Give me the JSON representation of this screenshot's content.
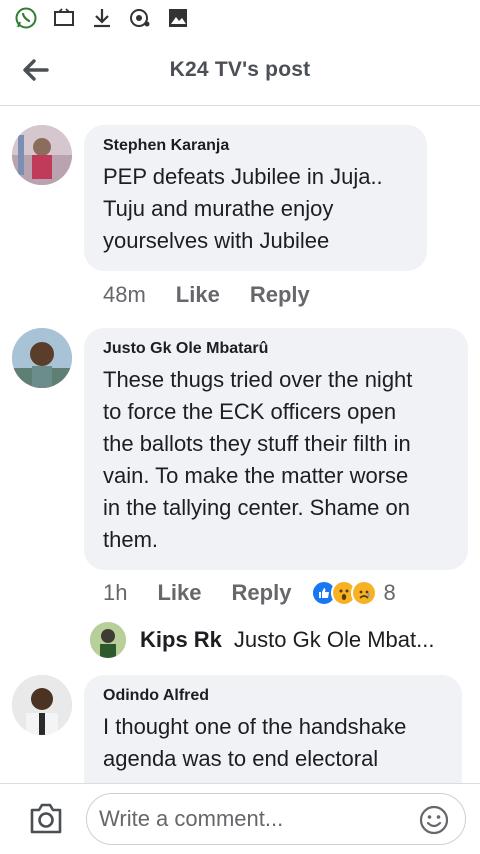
{
  "status_icons": [
    "whatsapp-icon",
    "cast-icon",
    "download-icon",
    "notification-icon",
    "gallery-icon"
  ],
  "header": {
    "title": "K24 TV's post",
    "back_icon": "arrow-left-icon"
  },
  "comments": [
    {
      "author": "Stephen Karanja",
      "text": "PEP defeats Jubilee in Juja..\nTuju and murathe enjoy yourselves with Jubilee",
      "time": "48m",
      "like": "Like",
      "reply": "Reply"
    },
    {
      "author": "Justo Gk Ole Mbatarû",
      "text": "These thugs tried over the night to force the ECK officers open the ballots they stuff their filth in vain. To make the matter worse in the tallying center. Shame on them.",
      "time": "1h",
      "like": "Like",
      "reply": "Reply",
      "reaction_count": "8",
      "reaction_icons": [
        "like-reaction-icon",
        "wow-reaction-icon",
        "sad-reaction-icon"
      ],
      "reply_preview": {
        "author": "Kips Rk",
        "text": "Justo Gk Ole Mbat..."
      }
    },
    {
      "author": "Odindo Alfred",
      "text": "I thought one of the  handshake agenda was to end electoral"
    }
  ],
  "composer": {
    "placeholder": "Write a comment...",
    "camera_icon": "camera-icon",
    "emoji_icon": "emoji-icon"
  },
  "colors": {
    "bubble": "#f0f2f5",
    "secondary_text": "#65676b",
    "title_text": "#4b4f56",
    "like_blue": "#1877f2",
    "whatsapp_green": "#25d366"
  }
}
